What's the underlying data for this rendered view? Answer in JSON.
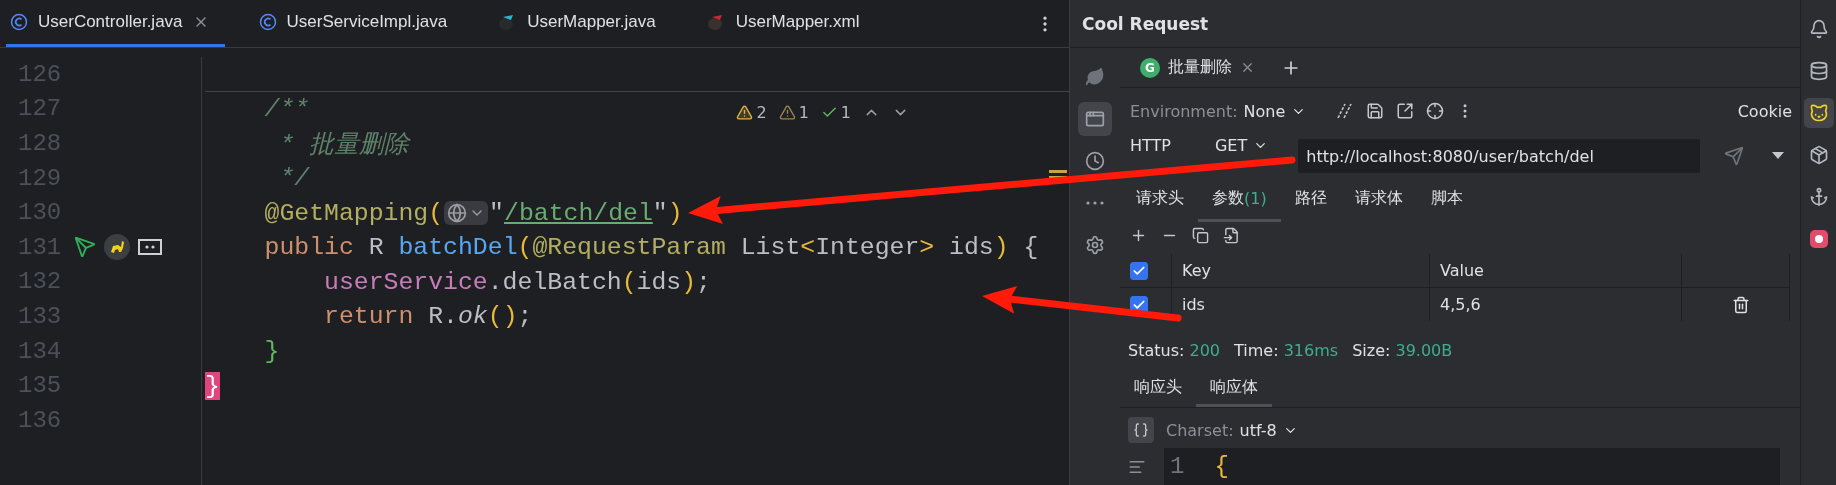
{
  "editor_tabs": [
    {
      "label": "UserController.java",
      "kind": "class",
      "selected": true,
      "closable": true
    },
    {
      "label": "UserServiceImpl.java",
      "kind": "class",
      "selected": false,
      "closable": false
    },
    {
      "label": "UserMapper.java",
      "kind": "mapper",
      "selected": false,
      "closable": false
    },
    {
      "label": "UserMapper.xml",
      "kind": "mapper-xml",
      "selected": false,
      "closable": false
    }
  ],
  "inspections": [
    {
      "kind": "warning",
      "count": "2"
    },
    {
      "kind": "weak-warning",
      "count": "1"
    },
    {
      "kind": "typo",
      "count": "1"
    }
  ],
  "code_lines": [
    {
      "number": "126",
      "separator": true
    },
    {
      "number": "127",
      "tokens": [
        {
          "text": "    /**",
          "kind": "comment"
        }
      ]
    },
    {
      "number": "128",
      "tokens": [
        {
          "text": "     * 批量删除",
          "kind": "comment"
        }
      ]
    },
    {
      "number": "129",
      "tokens": [
        {
          "text": "     */",
          "kind": "comment"
        }
      ]
    },
    {
      "number": "130",
      "tokens": [
        {
          "text": "    @GetMapping",
          "kind": "annotation"
        },
        {
          "text": "(",
          "kind": "paren"
        },
        {
          "kind": "inlay"
        },
        {
          "text": "\"",
          "kind": "plain"
        },
        {
          "text": "/batch/del",
          "kind": "url"
        },
        {
          "text": "\"",
          "kind": "plain"
        },
        {
          "text": ")",
          "kind": "paren"
        }
      ]
    },
    {
      "number": "131",
      "markers": [
        {
          "kind": "request"
        },
        {
          "kind": "plugin"
        },
        {
          "kind": "box"
        }
      ],
      "tokens": [
        {
          "text": "    public",
          "kind": "keyword"
        },
        {
          "text": " R ",
          "kind": "plain"
        },
        {
          "text": "batchDel",
          "kind": "method"
        },
        {
          "text": "(",
          "kind": "paren"
        },
        {
          "text": "@RequestParam",
          "kind": "annotation"
        },
        {
          "text": " List",
          "kind": "plain"
        },
        {
          "text": "<",
          "kind": "paren"
        },
        {
          "text": "Integer",
          "kind": "plain"
        },
        {
          "text": ">",
          "kind": "paren"
        },
        {
          "text": " ids",
          "kind": "plain"
        },
        {
          "text": ")",
          "kind": "paren"
        },
        {
          "text": " {",
          "kind": "plain"
        }
      ]
    },
    {
      "number": "132",
      "tokens": [
        {
          "text": "        userService",
          "kind": "field"
        },
        {
          "text": ".delBatch",
          "kind": "plain"
        },
        {
          "text": "(",
          "kind": "paren"
        },
        {
          "text": "ids",
          "kind": "plain"
        },
        {
          "text": ")",
          "kind": "paren"
        },
        {
          "text": ";",
          "kind": "plain"
        }
      ]
    },
    {
      "number": "133",
      "tokens": [
        {
          "text": "        return",
          "kind": "keyword"
        },
        {
          "text": " R.",
          "kind": "plain"
        },
        {
          "text": "ok",
          "kind": "static"
        },
        {
          "text": "()",
          "kind": "paren"
        },
        {
          "text": ";",
          "kind": "plain"
        }
      ]
    },
    {
      "number": "134",
      "tokens": [
        {
          "text": "    }",
          "kind": "brace"
        }
      ]
    },
    {
      "number": "135",
      "tokens": [
        {
          "text": "}",
          "kind": "match"
        }
      ]
    },
    {
      "number": "136"
    }
  ],
  "tool_window": {
    "title": "Cool Request",
    "side_icons": [
      {
        "kind": "leaf",
        "selected": false
      },
      {
        "kind": "api",
        "selected": true
      },
      {
        "kind": "history",
        "selected": false
      },
      {
        "kind": "more",
        "selected": false
      },
      {
        "kind": "settings",
        "selected": false
      }
    ],
    "request_tabs": [
      {
        "badge": "G",
        "label": "批量删除",
        "selected": true
      }
    ],
    "environment": {
      "label": "Environment:",
      "value": "None"
    },
    "cookie": "Cookie",
    "protocol": "HTTP",
    "method": "GET",
    "url": "http://localhost:8080/user/batch/del",
    "request_sections": [
      {
        "label": "请求头",
        "selected": false
      },
      {
        "label": "参数",
        "count": "(1)",
        "selected": true
      },
      {
        "label": "路径",
        "selected": false
      },
      {
        "label": "请求体",
        "selected": false
      },
      {
        "label": "脚本",
        "selected": false
      }
    ],
    "params": {
      "columns": [
        "Key",
        "Value"
      ],
      "all_checked": true,
      "rows": [
        {
          "key": "ids",
          "value": "4,5,6",
          "checked": true
        }
      ]
    },
    "status": [
      {
        "label": "Status:",
        "value": "200"
      },
      {
        "label": "Time:",
        "value": "316ms"
      },
      {
        "label": "Size:",
        "value": "39.00B"
      }
    ],
    "response_sections": [
      {
        "label": "响应头",
        "selected": false
      },
      {
        "label": "响应体",
        "selected": true
      }
    ],
    "charset": {
      "label": "Charset:",
      "value": "utf-8"
    },
    "response_lines": [
      {
        "number": "1",
        "text": "{"
      }
    ]
  },
  "right_strip": [
    {
      "kind": "bell",
      "selected": false
    },
    {
      "kind": "database",
      "selected": false
    },
    {
      "kind": "plugin",
      "selected": true
    },
    {
      "kind": "box",
      "selected": false
    },
    {
      "kind": "hook",
      "selected": false
    },
    {
      "kind": "badge",
      "selected": false
    }
  ],
  "annotations": [
    {
      "kind": "arrow"
    },
    {
      "kind": "arrow"
    }
  ]
}
